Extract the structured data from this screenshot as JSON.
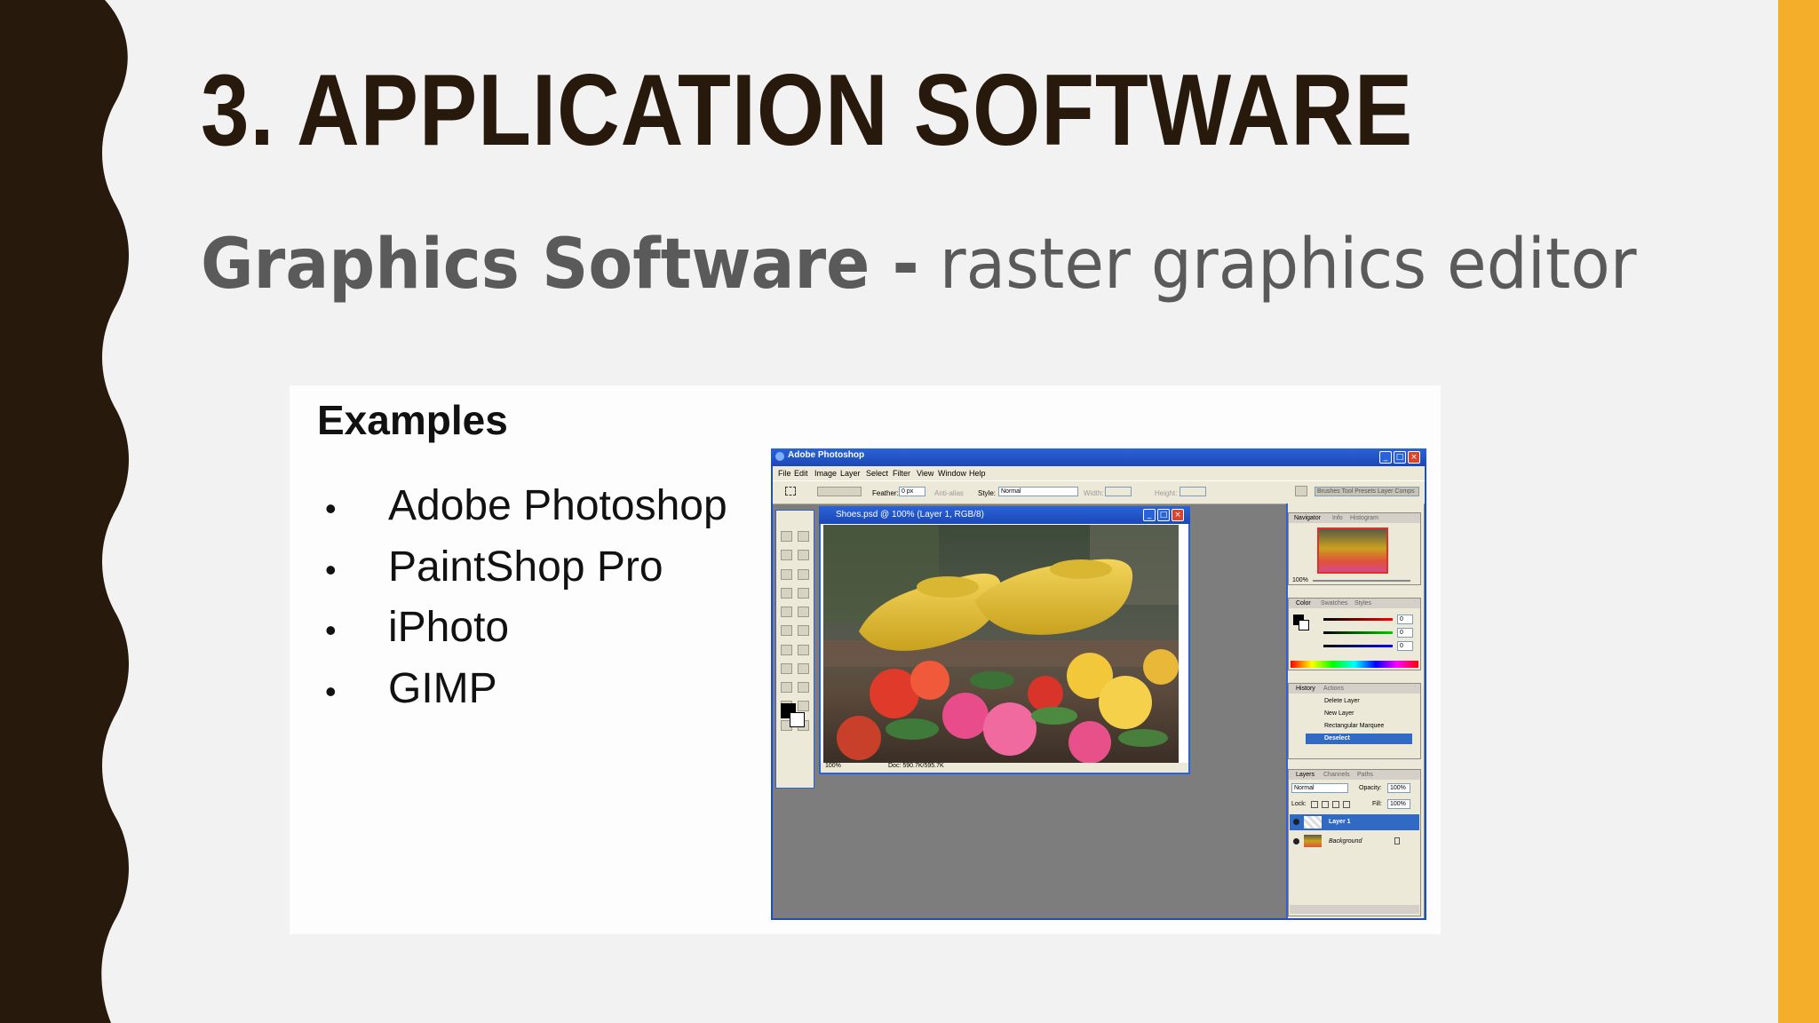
{
  "slide": {
    "title": "3. APPLICATION SOFTWARE",
    "subtitle_bold": "Graphics Software -",
    "subtitle_rest": " raster graphics editor",
    "colors": {
      "wave": "#27190b",
      "accent": "#f4ae29",
      "title": "#27190b",
      "subtitle": "#5a5a5a"
    }
  },
  "examples": {
    "heading": "Examples",
    "bullet_symbol": "•",
    "items": [
      "Adobe Photoshop",
      "PaintShop Pro",
      "iPhoto",
      "GIMP"
    ]
  },
  "photoshop": {
    "window_title": "Adobe Photoshop",
    "menus": [
      "File",
      "Edit",
      "Image",
      "Layer",
      "Select",
      "Filter",
      "View",
      "Window",
      "Help"
    ],
    "options": {
      "feather_label": "Feather:",
      "feather_value": "0 px",
      "antialias_label": "Anti-alias",
      "style_label": "Style:",
      "style_value": "Normal",
      "width_label": "Width:",
      "height_label": "Height:",
      "palette_well": "Brushes  Tool Presets  Layer Comps"
    },
    "document": {
      "title": "Shoes.psd @ 100% (Layer 1, RGB/8)",
      "zoom": "100%",
      "doc_size": "Doc: 590.7K/595.7K"
    },
    "navigator": {
      "tabs": [
        "Navigator",
        "Info",
        "Histogram"
      ],
      "zoom": "100%"
    },
    "color": {
      "tabs": [
        "Color",
        "Swatches",
        "Styles"
      ],
      "r": "0",
      "g": "0",
      "b": "0"
    },
    "history": {
      "tabs": [
        "History",
        "Actions"
      ],
      "steps": [
        "Delete Layer",
        "New Layer",
        "Rectangular Marquee",
        "Deselect"
      ]
    },
    "layers": {
      "tabs": [
        "Layers",
        "Channels",
        "Paths"
      ],
      "blend_mode": "Normal",
      "opacity_label": "Opacity:",
      "opacity_value": "100%",
      "lock_label": "Lock:",
      "fill_label": "Fill:",
      "fill_value": "100%",
      "items": [
        "Layer 1",
        "Background"
      ]
    }
  }
}
